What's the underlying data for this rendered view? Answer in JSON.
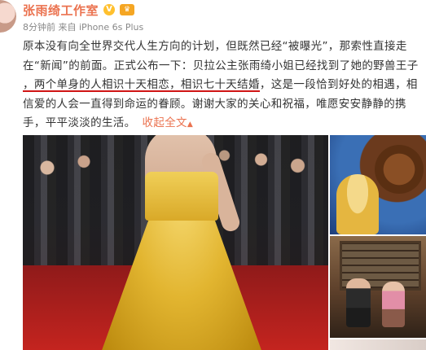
{
  "post": {
    "author": "张雨绮工作室",
    "verified_badge": "V",
    "vip_badge": "♛",
    "timestamp": "8分钟前",
    "source_prefix": "来自",
    "device": "iPhone 6s Plus",
    "text_lines": [
      "原本没有向全世界交代人生方向的计划，但既然已经“被曝光”，那索性直接走",
      "在“新闻”的前面。正式公布一下：贝拉公主张雨绮小姐已经找到了她的野兽王子"
    ],
    "line3_highlight_1": "，两个单身的人相识十天相恋",
    "line3_highlight_2": "，相识七十天结婚",
    "line3_rest": "，这是一段恰到好处的相遇，相",
    "text_line4": "信爱的人会一直得到命运的眷顾。谢谢大家的关心和祝福，唯愿安安静静的携",
    "text_line5": "手，平平淡淡的生活。",
    "collapse_label": "收起全文",
    "collapse_arrow": "▲"
  },
  "colors": {
    "author": "#eb7350",
    "link": "#eb7350",
    "underline": "#d01515",
    "meta": "#888888",
    "text": "#333333"
  },
  "images": [
    {
      "name": "red-carpet-gold-gown-photo"
    },
    {
      "name": "beauty-and-the-beast-illustration"
    },
    {
      "name": "couple-seated-photo"
    },
    {
      "name": "partial-thumbnail"
    }
  ]
}
